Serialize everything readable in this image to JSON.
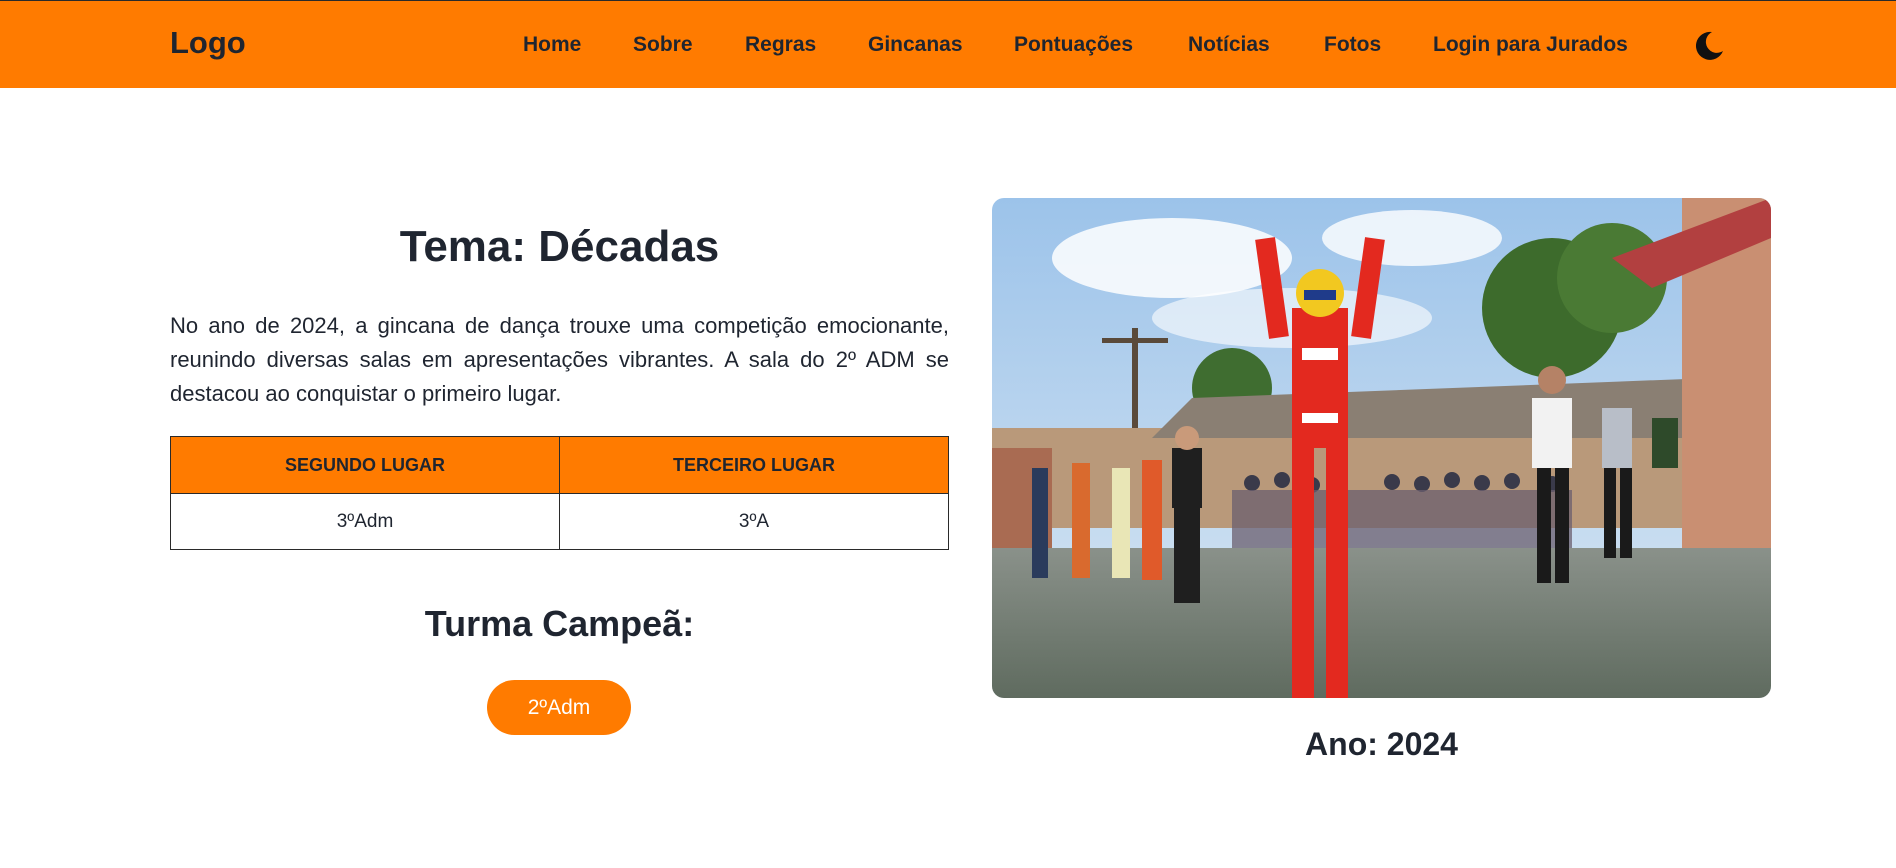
{
  "header": {
    "logo": "Logo",
    "nav": [
      "Home",
      "Sobre",
      "Regras",
      "Gincanas",
      "Pontuações",
      "Notícias",
      "Fotos",
      "Login para Jurados"
    ],
    "theme_toggle_icon": "moon-icon"
  },
  "main": {
    "theme_title": "Tema: Décadas",
    "description": "No ano de 2024, a gincana de dança trouxe uma competição emocionante, reunindo diversas salas em apresentações vibrantes. A sala do 2º ADM se destacou ao conquistar o primeiro lugar.",
    "table": {
      "headers": [
        "SEGUNDO LUGAR",
        "TERCEIRO LUGAR"
      ],
      "row": [
        "3ºAdm",
        "3ºA"
      ]
    },
    "champion_title": "Turma Campeã:",
    "champion_badge": "2ºAdm",
    "year_caption": "Ano: 2024"
  },
  "colors": {
    "accent": "#ff7b00",
    "text": "#1f2530",
    "background": "#ffffff"
  }
}
